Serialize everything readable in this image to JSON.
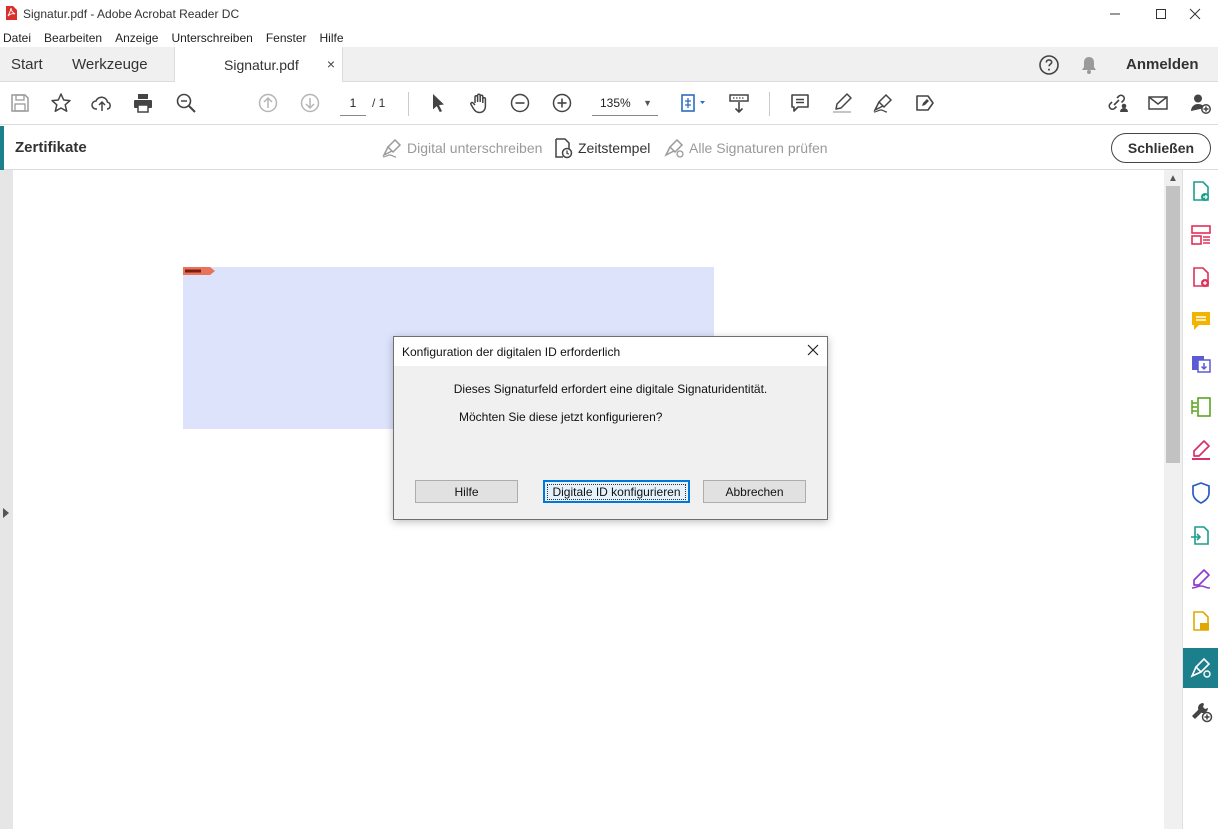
{
  "window": {
    "title": "Signatur.pdf - Adobe Acrobat Reader DC"
  },
  "menu": [
    "Datei",
    "Bearbeiten",
    "Anzeige",
    "Unterschreiben",
    "Fenster",
    "Hilfe"
  ],
  "tabs": {
    "start": "Start",
    "tools": "Werkzeuge",
    "document": "Signatur.pdf",
    "close": "×",
    "signin": "Anmelden"
  },
  "toolbar": {
    "page_current": "1",
    "page_total": "/ 1",
    "zoom": "135%"
  },
  "certbar": {
    "title": "Zertifikate",
    "sign_digitally": "Digital unterschreiben",
    "timestamp": "Zeitstempel",
    "validate_all": "Alle Signaturen prüfen",
    "close": "Schließen",
    "accent_color": "#1b7f8c"
  },
  "dialog": {
    "title": "Konfiguration der digitalen ID erforderlich",
    "message1": "Dieses Signaturfeld erfordert eine digitale Signaturidentität.",
    "message2": "Möchten Sie diese jetzt konfigurieren?",
    "help_button": "Hilfe",
    "configure_button": "Digitale ID konfigurieren",
    "cancel_button": "Abbrechen"
  },
  "right_pane_icons": [
    "export-pdf-icon",
    "organize-pages-icon",
    "create-pdf-icon",
    "comment-icon",
    "send-for-review-icon",
    "scan-icon",
    "fill-sign-icon",
    "protect-icon",
    "share-icon",
    "sign-icon",
    "send-comments-icon",
    "certificates-icon",
    "more-tools-icon"
  ]
}
